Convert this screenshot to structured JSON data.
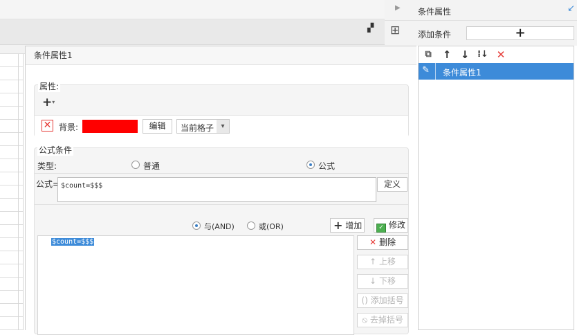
{
  "right_panel": {
    "title": "条件属性",
    "add_condition_label": "添加条件",
    "add_icon": "plus-icon",
    "list_items": [
      {
        "label": "条件属性1",
        "icon": "pencil-icon"
      }
    ],
    "toolbar_icons": [
      "copy-icon",
      "arrow-up-icon",
      "arrow-down-icon",
      "sort-down-icon",
      "delete-icon"
    ]
  },
  "dialog": {
    "title": "条件属性1",
    "attribute_section": {
      "label": "属性:",
      "row": {
        "name": "背景:",
        "color": "#ff0000",
        "edit_label": "编辑",
        "scope_value": "当前格子"
      }
    },
    "formula_section": {
      "label": "公式条件",
      "type_label": "类型:",
      "type_options": [
        {
          "label": "普通",
          "selected": false
        },
        {
          "label": "公式",
          "selected": true
        }
      ],
      "formula_label": "公式=",
      "formula_value": "$count=$$$",
      "define_label": "定义",
      "logic_options": [
        {
          "label": "与(AND)",
          "selected": true
        },
        {
          "label": "或(OR)",
          "selected": false
        }
      ],
      "add_label": "增加",
      "modify_label": "修改",
      "conditions": [
        "$count=$$$"
      ],
      "side_buttons": {
        "delete": "删除",
        "move_up": "上移",
        "move_down": "下移",
        "add_bracket": "添加括号",
        "remove_bracket": "去掉括号"
      }
    }
  },
  "colors": {
    "accent": "#3d8bd9",
    "delete": "#e53935",
    "selection": "#3d8bd9"
  }
}
